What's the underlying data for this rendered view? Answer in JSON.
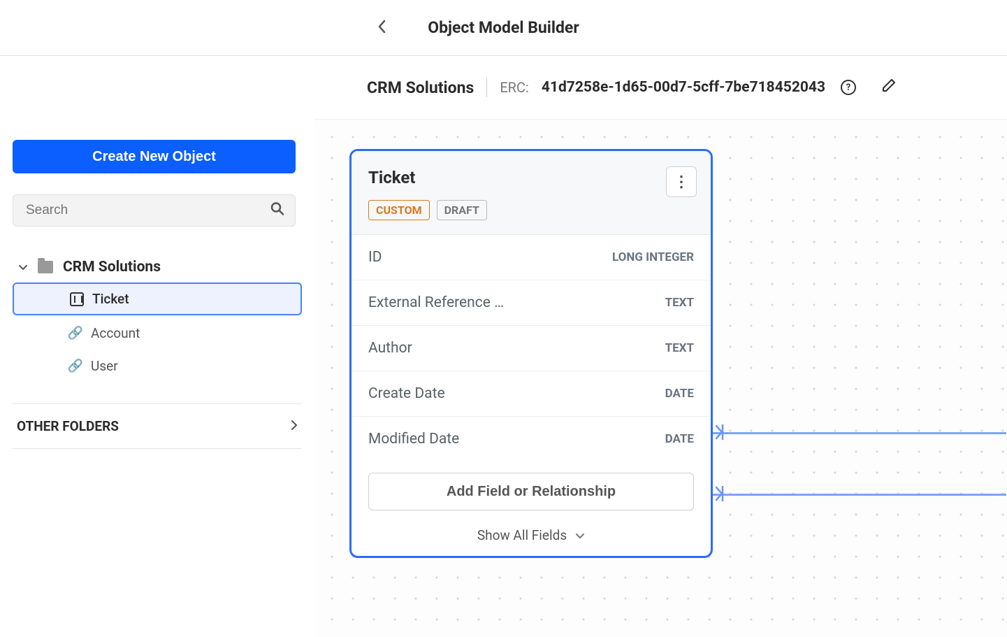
{
  "header": {
    "title": "Object Model Builder"
  },
  "subheader": {
    "title": "CRM Solutions",
    "erc_label": "ERC:",
    "erc_value": "41d7258e-1d65-00d7-5cff-7be718452043"
  },
  "sidebar": {
    "create_button": "Create New Object",
    "search_placeholder": "Search",
    "folder_name": "CRM Solutions",
    "items": [
      {
        "label": "Ticket",
        "type": "object",
        "selected": true
      },
      {
        "label": "Account",
        "type": "link",
        "selected": false
      },
      {
        "label": "User",
        "type": "link",
        "selected": false
      }
    ],
    "other_folders": "OTHER FOLDERS"
  },
  "object_card": {
    "title": "Ticket",
    "badges": {
      "custom": "CUSTOM",
      "draft": "DRAFT"
    },
    "fields": [
      {
        "name": "ID",
        "type": "LONG INTEGER"
      },
      {
        "name": "External Reference …",
        "type": "TEXT"
      },
      {
        "name": "Author",
        "type": "TEXT"
      },
      {
        "name": "Create Date",
        "type": "DATE"
      },
      {
        "name": "Modified Date",
        "type": "DATE"
      }
    ],
    "add_button": "Add Field or Relationship",
    "show_all": "Show All Fields"
  }
}
